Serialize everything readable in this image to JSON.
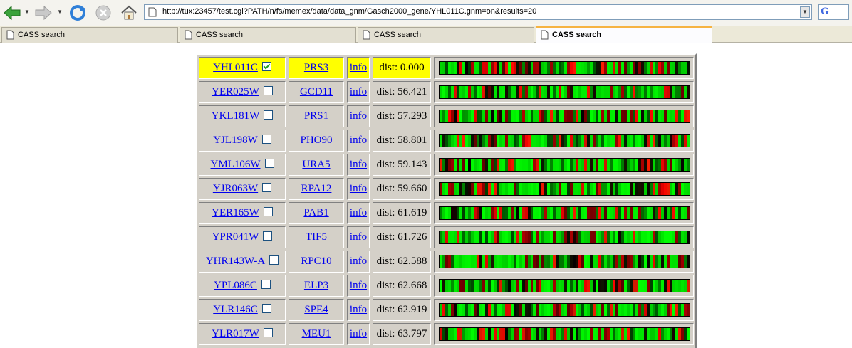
{
  "browser": {
    "url": "http://tux:23457/test.cgi?PATH/n/fs/memex/data/data_gnm/Gasch2000_gene/YHL011C.gnm=on&results=20",
    "tabs": [
      {
        "label": "CASS search",
        "active": false
      },
      {
        "label": "CASS search",
        "active": false
      },
      {
        "label": "CASS search",
        "active": false
      },
      {
        "label": "CASS search",
        "active": true
      }
    ],
    "search_engine_label": "G"
  },
  "colors": {
    "highlight": "#ffff00",
    "link": "#0000ee",
    "heat_high": "#00ff00",
    "heat_low": "#ff0000",
    "heat_mid": "#000000"
  },
  "results": [
    {
      "orf": "YHL011C",
      "checked": true,
      "gene": "PRS3",
      "info": "info",
      "dist": "dist: 0.000",
      "highlight": true
    },
    {
      "orf": "YER025W",
      "checked": false,
      "gene": "GCD11",
      "info": "info",
      "dist": "dist: 56.421",
      "highlight": false
    },
    {
      "orf": "YKL181W",
      "checked": false,
      "gene": "PRS1",
      "info": "info",
      "dist": "dist: 57.293",
      "highlight": false
    },
    {
      "orf": "YJL198W",
      "checked": false,
      "gene": "PHO90",
      "info": "info",
      "dist": "dist: 58.801",
      "highlight": false
    },
    {
      "orf": "YML106W",
      "checked": false,
      "gene": "URA5",
      "info": "info",
      "dist": "dist: 59.143",
      "highlight": false
    },
    {
      "orf": "YJR063W",
      "checked": false,
      "gene": "RPA12",
      "info": "info",
      "dist": "dist: 59.660",
      "highlight": false
    },
    {
      "orf": "YER165W",
      "checked": false,
      "gene": "PAB1",
      "info": "info",
      "dist": "dist: 61.619",
      "highlight": false
    },
    {
      "orf": "YPR041W",
      "checked": false,
      "gene": "TIF5",
      "info": "info",
      "dist": "dist: 61.726",
      "highlight": false
    },
    {
      "orf": "YHR143W-A",
      "checked": false,
      "gene": "RPC10",
      "info": "info",
      "dist": "dist: 62.588",
      "highlight": false
    },
    {
      "orf": "YPL086C",
      "checked": false,
      "gene": "ELP3",
      "info": "info",
      "dist": "dist: 62.668",
      "highlight": false
    },
    {
      "orf": "YLR146C",
      "checked": false,
      "gene": "SPE4",
      "info": "info",
      "dist": "dist: 62.919",
      "highlight": false
    },
    {
      "orf": "YLR017W",
      "checked": false,
      "gene": "MEU1",
      "info": "info",
      "dist": "dist: 63.797",
      "highlight": false
    }
  ]
}
